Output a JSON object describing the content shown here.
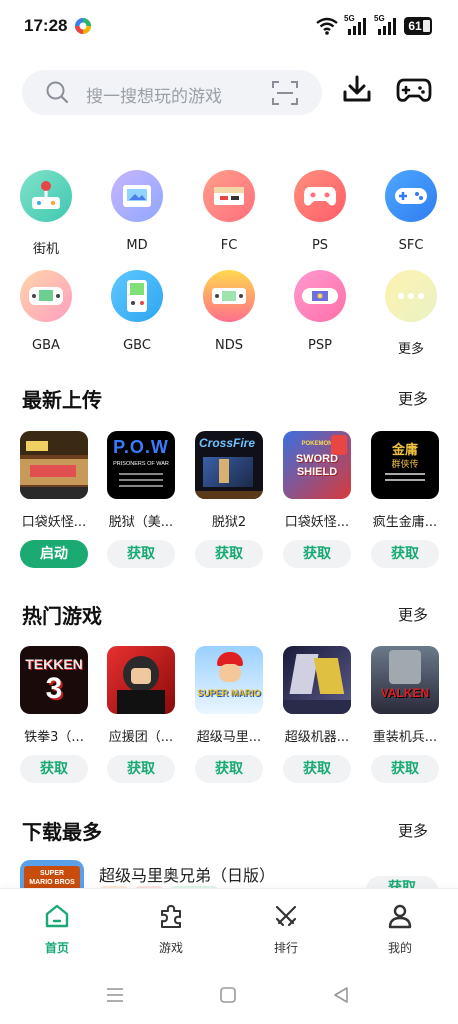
{
  "status": {
    "time": "17:28",
    "network_1": "5G",
    "network_2": "5G",
    "battery": "61"
  },
  "search": {
    "placeholder": "搜一搜想玩的游戏"
  },
  "platforms": [
    {
      "label": "街机",
      "icon": "arcade-joystick-icon"
    },
    {
      "label": "MD",
      "icon": "md-console-icon"
    },
    {
      "label": "FC",
      "icon": "fc-console-icon"
    },
    {
      "label": "PS",
      "icon": "ps-controller-icon"
    },
    {
      "label": "SFC",
      "icon": "sfc-controller-icon"
    },
    {
      "label": "GBA",
      "icon": "gba-handheld-icon"
    },
    {
      "label": "GBC",
      "icon": "gbc-handheld-icon"
    },
    {
      "label": "NDS",
      "icon": "nds-handheld-icon"
    },
    {
      "label": "PSP",
      "icon": "psp-handheld-icon"
    },
    {
      "label": "更多",
      "icon": "more-dots-icon"
    }
  ],
  "latest": {
    "title": "最新上传",
    "more": "更多",
    "items": [
      {
        "name": "口袋妖怪...",
        "button": "启动",
        "thumb": "pokemon-pixel-thumbnail"
      },
      {
        "name": "脱狱（美...",
        "button": "获取",
        "thumb": "pow-thumbnail",
        "thumb_text": "P.O.W",
        "thumb_sub": "PRISONERS OF WAR"
      },
      {
        "name": "脱狱2",
        "button": "获取",
        "thumb": "crossfire-thumbnail",
        "thumb_text": "CrossFire"
      },
      {
        "name": "口袋妖怪...",
        "button": "获取",
        "thumb": "pokemon-sword-shield-thumbnail",
        "thumb_text": "SWORD SHIELD",
        "thumb_sub": "POKEMON"
      },
      {
        "name": "疯生金庸...",
        "button": "获取",
        "thumb": "jinyong-thumbnail",
        "thumb_text": "金庸",
        "thumb_sub": "群侠传"
      }
    ]
  },
  "hot": {
    "title": "热门游戏",
    "more": "更多",
    "items": [
      {
        "name": "铁拳3（...",
        "button": "获取",
        "thumb": "tekken3-thumbnail",
        "thumb_text": "TEKKEN",
        "thumb_sub": "3"
      },
      {
        "name": "应援团（...",
        "button": "获取",
        "thumb": "ouendan-thumbnail"
      },
      {
        "name": "超级马里...",
        "button": "获取",
        "thumb": "super-mario-64-thumbnail",
        "thumb_text": "SUPER MARIO"
      },
      {
        "name": "超级机器...",
        "button": "获取",
        "thumb": "super-robot-thumbnail"
      },
      {
        "name": "重装机兵...",
        "button": "获取",
        "thumb": "valken-thumbnail",
        "thumb_text": "VALKEN"
      }
    ]
  },
  "most_downloaded": {
    "title": "下载最多",
    "more": "更多",
    "first": {
      "name": "超级马里奥兄弟（日版）",
      "button": "获取",
      "thumb_text": "SUPER MARIO BROS"
    }
  },
  "nav": [
    {
      "label": "首页",
      "icon": "home-icon",
      "active": true
    },
    {
      "label": "游戏",
      "icon": "puzzle-icon",
      "active": false
    },
    {
      "label": "排行",
      "icon": "swords-icon",
      "active": false
    },
    {
      "label": "我的",
      "icon": "user-icon",
      "active": false
    }
  ],
  "colors": {
    "accent": "#1aaa72",
    "accent_text": "#19a974",
    "button_bg": "#f1f2f4",
    "search_bg": "#f2f3f6"
  }
}
